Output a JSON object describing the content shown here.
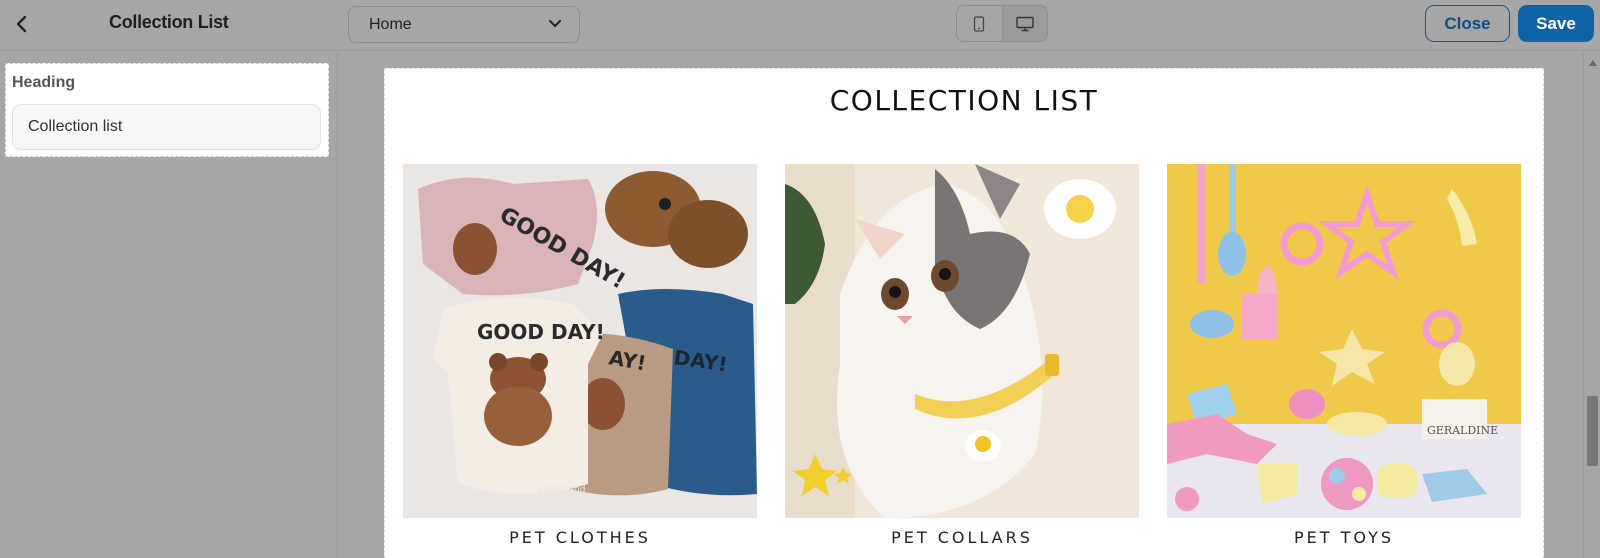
{
  "header": {
    "back_icon": "chevron-left-icon",
    "title": "Collection List",
    "page_select": {
      "value": "Home",
      "icon": "chevron-down-icon"
    },
    "device_toggle": [
      {
        "icon": "mobile-icon",
        "active": false
      },
      {
        "icon": "desktop-icon",
        "active": true
      }
    ],
    "close_label": "Close",
    "save_label": "Save",
    "accent_color": "#0e64a6"
  },
  "sidebar": {
    "setting_label": "Heading",
    "setting_value": "Collection list"
  },
  "preview": {
    "heading": "COLLECTION LIST",
    "cards": [
      {
        "title": "PET CLOTHES",
        "image": "pet-clothes-image"
      },
      {
        "title": "PET COLLARS",
        "image": "pet-collars-image"
      },
      {
        "title": "PET TOYS",
        "image": "pet-toys-image"
      }
    ]
  }
}
